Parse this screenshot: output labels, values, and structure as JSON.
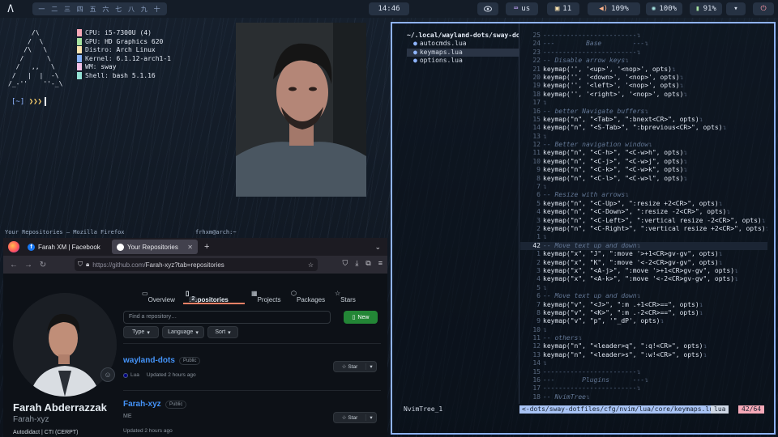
{
  "topbar": {
    "logo": "Λ",
    "workspaces": [
      "一",
      "二",
      "三",
      "四",
      "五",
      "六",
      "七",
      "八",
      "九",
      "十"
    ],
    "clock": "14:46",
    "eye_icon": "eye-icon",
    "keyboard_layout": "us",
    "updates": "11",
    "volume": "109%",
    "brightness": "100%",
    "battery": "91%",
    "power_icon": "power-icon",
    "accent": "#8fb3ff"
  },
  "neofetch": {
    "ascii": "      /\\\n     /  \\\n    /\\   \\\n   /      \\\n  /   ,,   \\\n /   |  |  -\\\n/_-''    ''-_\\",
    "lines": [
      {
        "key": "CPU",
        "value": "i5-7300U (4)",
        "color": "#f7a8b8"
      },
      {
        "key": "GPU",
        "value": "HD Graphics 620",
        "color": "#a6e3a1"
      },
      {
        "key": "Distro",
        "value": "Arch Linux",
        "color": "#f9e2af"
      },
      {
        "key": "Kernel",
        "value": "6.1.12-arch1-1",
        "color": "#89b4fa"
      },
      {
        "key": "WM",
        "value": "sway",
        "color": "#f5c2e7"
      },
      {
        "key": "Shell",
        "value": "bash 5.1.16",
        "color": "#94e2d5"
      }
    ],
    "prompt_dir": "[~]",
    "prompt_arrows": "❯❯❯"
  },
  "titles": {
    "firefox": "Your Repositories — Mozilla Firefox",
    "terminal": "frhxm@arch:~"
  },
  "firefox": {
    "tabs": [
      {
        "label": "Farah XM | Facebook",
        "active": false
      },
      {
        "label": "Your Repositories",
        "active": true
      }
    ],
    "url_prefix": "https://github.com/",
    "url_rest": "Farah-xyz?tab=repositories",
    "github": {
      "nav": [
        "Overview",
        "Repositories",
        "Projects",
        "Packages",
        "Stars"
      ],
      "repo_count": "2",
      "find_placeholder": "Find a repository…",
      "new_label": "New",
      "filters": [
        "Type",
        "Language",
        "Sort"
      ],
      "name": "Farah Abderrazzak",
      "login": "Farah-xyz",
      "bio": "Autodidact | CTI (CERPT)",
      "repos": [
        {
          "name": "wayland-dots",
          "visibility": "Public",
          "desc": "",
          "lang": "Lua",
          "updated": "Updated 2 hours ago"
        },
        {
          "name": "Farah-xyz",
          "visibility": "Public",
          "desc": "ME",
          "lang": "",
          "updated": "Updated 2 hours ago"
        }
      ],
      "star_label": "Star"
    }
  },
  "nvim": {
    "tree_root": "~/.local/wayland-dots/sway-dot",
    "tree_files": [
      {
        "name": "autocmds.lua",
        "current": false
      },
      {
        "name": "keymaps.lua",
        "current": true
      },
      {
        "name": "options.lua",
        "current": false
      }
    ],
    "lines": [
      {
        "n": "25",
        "t": "------------------------",
        "c": true
      },
      {
        "n": "24",
        "t": "---        Base        ---",
        "c": true
      },
      {
        "n": "23",
        "t": "------------------------",
        "c": true
      },
      {
        "n": "22",
        "t": "-- Disable arrow keys",
        "c": true
      },
      {
        "n": "21",
        "t": "keymap('', '<up>', '<nop>', opts)",
        "c": false
      },
      {
        "n": "20",
        "t": "keymap('', '<down>', '<nop>', opts)",
        "c": false
      },
      {
        "n": "19",
        "t": "keymap('', '<left>', '<nop>', opts)",
        "c": false
      },
      {
        "n": "18",
        "t": "keymap('', '<right>', '<nop>', opts)",
        "c": false
      },
      {
        "n": "17",
        "t": "",
        "c": false
      },
      {
        "n": "16",
        "t": "-- better Navigate buffers",
        "c": true
      },
      {
        "n": "15",
        "t": "keymap(\"n\", \"<Tab>\", \":bnext<CR>\", opts)",
        "c": false
      },
      {
        "n": "14",
        "t": "keymap(\"n\", \"<S-Tab>\", \":bprevious<CR>\", opts)",
        "c": false
      },
      {
        "n": "13",
        "t": "",
        "c": false
      },
      {
        "n": "12",
        "t": "-- Better navigation window",
        "c": true
      },
      {
        "n": "11",
        "t": "keymap(\"n\", \"<C-h>\", \"<C-w>h\", opts)",
        "c": false
      },
      {
        "n": "10",
        "t": "keymap(\"n\", \"<C-j>\", \"<C-w>j\", opts)",
        "c": false
      },
      {
        "n": "9",
        "t": "keymap(\"n\", \"<C-k>\", \"<C-w>k\", opts)",
        "c": false
      },
      {
        "n": "8",
        "t": "keymap(\"n\", \"<C-l>\", \"<C-w>l\", opts)",
        "c": false
      },
      {
        "n": "7",
        "t": "",
        "c": false
      },
      {
        "n": "6",
        "t": "-- Resize with arrows",
        "c": true
      },
      {
        "n": "5",
        "t": "keymap(\"n\", \"<C-Up>\", \":resize +2<CR>\", opts)",
        "c": false
      },
      {
        "n": "4",
        "t": "keymap(\"n\", \"<C-Down>\", \":resize -2<CR>\", opts)",
        "c": false
      },
      {
        "n": "3",
        "t": "keymap(\"n\", \"<C-Left>\", \":vertical resize -2<CR>\", opts)",
        "c": false
      },
      {
        "n": "2",
        "t": "keymap(\"n\", \"<C-Right>\", \":vertical resize +2<CR>\", opts)",
        "c": false
      },
      {
        "n": "1",
        "t": "",
        "c": false
      },
      {
        "n": "42",
        "t": "-- Move text up and down",
        "c": true,
        "cur": true
      },
      {
        "n": "1",
        "t": "keymap(\"x\", \"J\", \":move '>+1<CR>gv-gv\", opts)",
        "c": false
      },
      {
        "n": "2",
        "t": "keymap(\"x\", \"K\", \":move '<-2<CR>gv-gv\", opts)",
        "c": false
      },
      {
        "n": "3",
        "t": "keymap(\"x\", \"<A-j>\", \":move '>+1<CR>gv-gv\", opts)",
        "c": false
      },
      {
        "n": "4",
        "t": "keymap(\"x\", \"<A-k>\", \":move '<-2<CR>gv-gv\", opts)",
        "c": false
      },
      {
        "n": "5",
        "t": "",
        "c": false
      },
      {
        "n": "6",
        "t": "-- Move text up and down",
        "c": true
      },
      {
        "n": "7",
        "t": "keymap(\"v\", \"<J>\", \":m .+1<CR>==\", opts)",
        "c": false
      },
      {
        "n": "8",
        "t": "keymap(\"v\", \"<K>\", \":m .-2<CR>==\", opts)",
        "c": false
      },
      {
        "n": "9",
        "t": "keymap(\"v\", \"p\", '\"_dP', opts)",
        "c": false
      },
      {
        "n": "10",
        "t": "",
        "c": false
      },
      {
        "n": "11",
        "t": "-- others",
        "c": true
      },
      {
        "n": "12",
        "t": "keymap(\"n\", \"<leader>q\", \":q!<CR>\", opts)",
        "c": false
      },
      {
        "n": "13",
        "t": "keymap(\"n\", \"<leader>s\", \":w!<CR>\", opts)",
        "c": false
      },
      {
        "n": "14",
        "t": "",
        "c": false
      },
      {
        "n": "15",
        "t": "------------------------",
        "c": true
      },
      {
        "n": "16",
        "t": "---       Plugins      ---",
        "c": true
      },
      {
        "n": "17",
        "t": "------------------------",
        "c": true
      },
      {
        "n": "18",
        "t": "-- NvimTree",
        "c": true
      }
    ],
    "status_left": "NvimTree_1",
    "status_path": "<-dots/sway-dotfiles/cfg/nvim/lua/core/keymaps.lua",
    "status_ft": "lua",
    "status_pos": "42/64"
  }
}
